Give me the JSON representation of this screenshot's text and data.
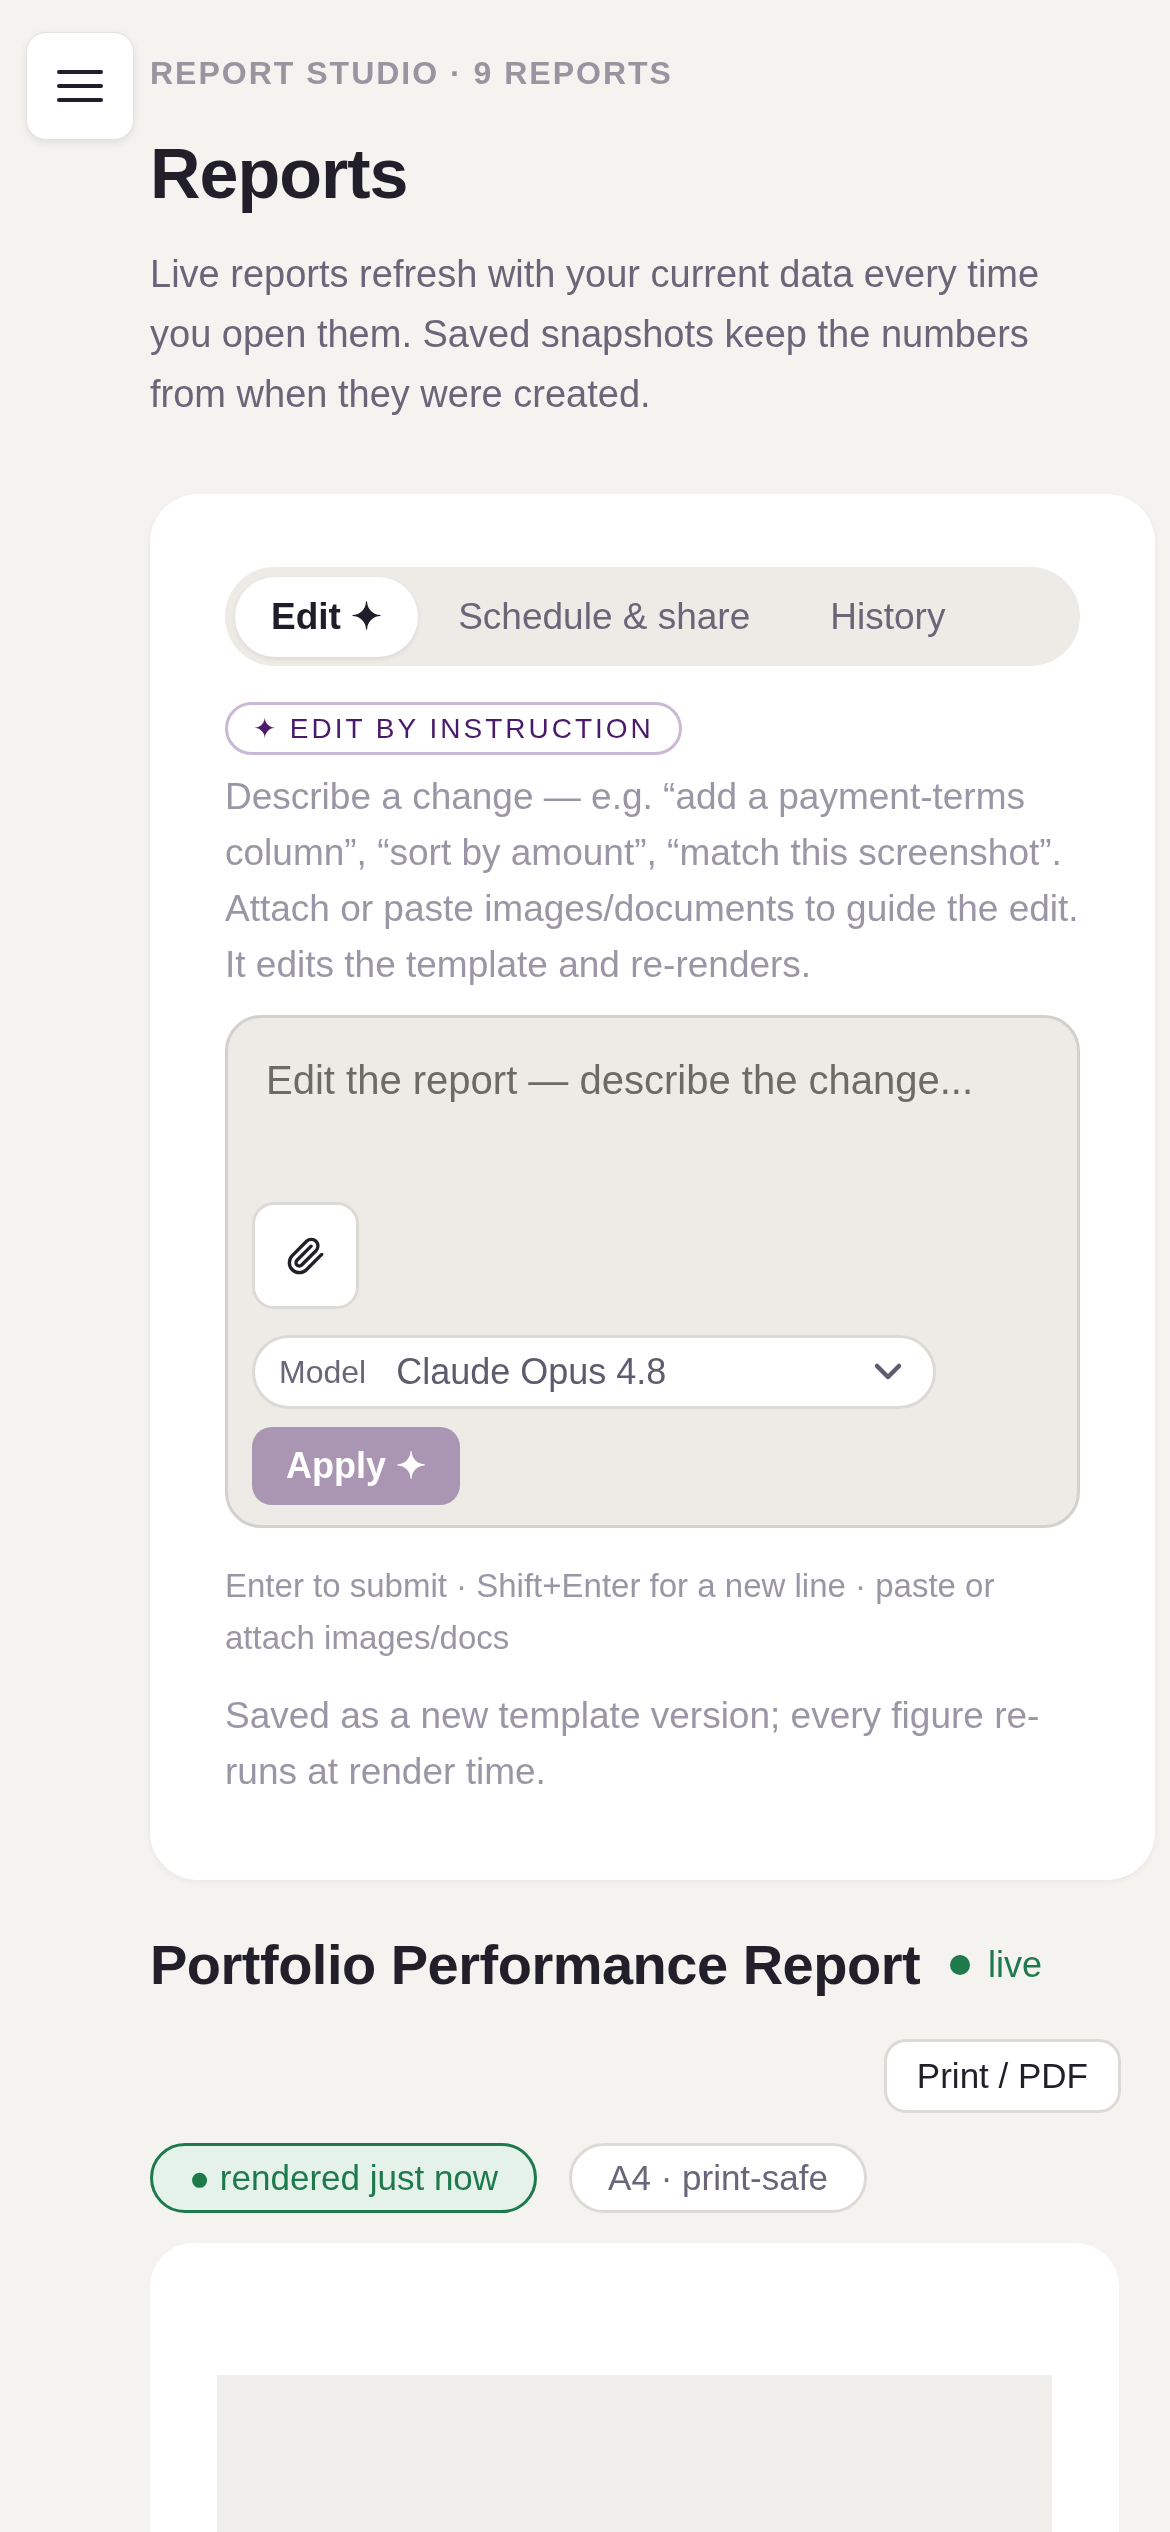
{
  "header": {
    "eyebrow": "REPORT STUDIO · 9 REPORTS",
    "title": "Reports",
    "description": "Live reports refresh with your current data every time you open them. Saved snapshots keep the numbers from when they were created."
  },
  "editor": {
    "tabs": [
      {
        "label": "Edit ✦",
        "selected": true
      },
      {
        "label": "Schedule & share",
        "selected": false
      },
      {
        "label": "History",
        "selected": false
      }
    ],
    "badge": "✦ EDIT BY INSTRUCTION",
    "help": "Describe a change — e.g. “add a payment-terms column”, “sort by amount”, “match this screenshot”. Attach or paste images/documents to guide the edit. It edits the template and re-renders.",
    "input": {
      "placeholder": "Edit the report — describe the change..."
    },
    "model": {
      "label": "Model",
      "value": "Claude Opus 4.8"
    },
    "apply": {
      "label": "Apply ✦",
      "disabled": true
    },
    "hint": "Enter to submit · Shift+Enter for a new line · paste or attach images/docs",
    "note": "Saved as a new template version; every figure re-runs at render time."
  },
  "report": {
    "title": "Portfolio Performance Report",
    "status": {
      "label": "live",
      "color": "#1e7a4c"
    },
    "print_button": "Print / PDF",
    "chips": [
      {
        "label": "● rendered just now",
        "kind": "status"
      },
      {
        "label": "A4 · print-safe",
        "kind": "plain"
      }
    ]
  }
}
